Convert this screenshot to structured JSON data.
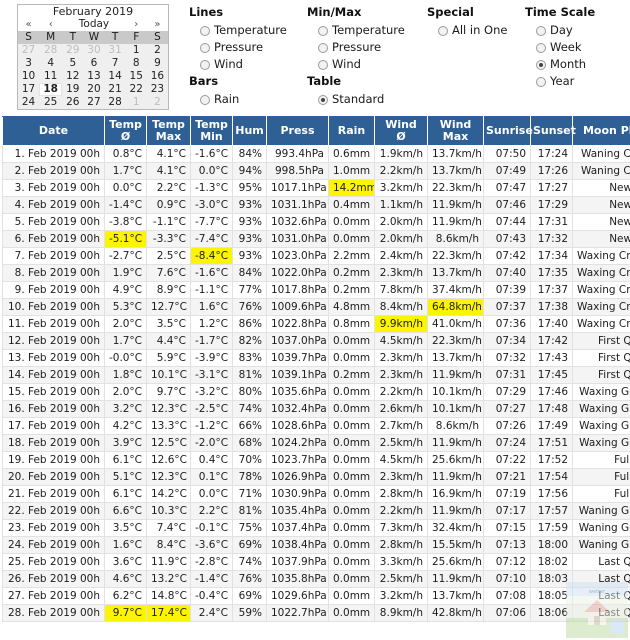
{
  "calendar": {
    "title": "February 2019",
    "nav": {
      "first": "«",
      "prev": "‹",
      "today": "Today",
      "next": "›",
      "last": "»"
    },
    "dow": [
      "S",
      "M",
      "T",
      "W",
      "T",
      "F",
      "S"
    ],
    "weeks": [
      [
        {
          "d": "27",
          "o": true
        },
        {
          "d": "28",
          "o": true
        },
        {
          "d": "29",
          "o": true
        },
        {
          "d": "30",
          "o": true
        },
        {
          "d": "31",
          "o": true
        },
        {
          "d": "1",
          "o": false
        },
        {
          "d": "2",
          "o": false
        }
      ],
      [
        {
          "d": "3",
          "o": false
        },
        {
          "d": "4",
          "o": false
        },
        {
          "d": "5",
          "o": false
        },
        {
          "d": "6",
          "o": false
        },
        {
          "d": "7",
          "o": false
        },
        {
          "d": "8",
          "o": false
        },
        {
          "d": "9",
          "o": false
        }
      ],
      [
        {
          "d": "10",
          "o": false
        },
        {
          "d": "11",
          "o": false
        },
        {
          "d": "12",
          "o": false
        },
        {
          "d": "13",
          "o": false
        },
        {
          "d": "14",
          "o": false
        },
        {
          "d": "15",
          "o": false
        },
        {
          "d": "16",
          "o": false
        }
      ],
      [
        {
          "d": "17",
          "o": false
        },
        {
          "d": "18",
          "o": false,
          "sel": true
        },
        {
          "d": "19",
          "o": false
        },
        {
          "d": "20",
          "o": false
        },
        {
          "d": "21",
          "o": false
        },
        {
          "d": "22",
          "o": false
        },
        {
          "d": "23",
          "o": false
        }
      ],
      [
        {
          "d": "24",
          "o": false
        },
        {
          "d": "25",
          "o": false
        },
        {
          "d": "26",
          "o": false
        },
        {
          "d": "27",
          "o": false
        },
        {
          "d": "28",
          "o": false
        },
        {
          "d": "1",
          "o": true
        },
        {
          "d": "2",
          "o": true
        }
      ]
    ]
  },
  "options": {
    "lines": {
      "title": "Lines",
      "items": [
        {
          "label": "Temperature",
          "checked": false
        },
        {
          "label": "Pressure",
          "checked": false
        },
        {
          "label": "Wind",
          "checked": false
        }
      ]
    },
    "bars": {
      "title": "Bars",
      "items": [
        {
          "label": "Rain",
          "checked": false
        }
      ]
    },
    "minmax": {
      "title": "Min/Max",
      "items": [
        {
          "label": "Temperature",
          "checked": false
        },
        {
          "label": "Pressure",
          "checked": false
        },
        {
          "label": "Wind",
          "checked": false
        }
      ]
    },
    "table": {
      "title": "Table",
      "items": [
        {
          "label": "Standard",
          "checked": true
        }
      ]
    },
    "special": {
      "title": "Special",
      "items": [
        {
          "label": "All in One",
          "checked": false
        }
      ]
    },
    "time": {
      "title": "Time Scale",
      "items": [
        {
          "label": "Day",
          "checked": false
        },
        {
          "label": "Week",
          "checked": false
        },
        {
          "label": "Month",
          "checked": true
        },
        {
          "label": "Year",
          "checked": false
        }
      ]
    }
  },
  "table": {
    "columns": [
      {
        "key": "date",
        "label": "Date"
      },
      {
        "key": "tavg",
        "label": "Temp\nØ"
      },
      {
        "key": "tmax",
        "label": "Temp\nMax"
      },
      {
        "key": "tmin",
        "label": "Temp\nMin"
      },
      {
        "key": "hum",
        "label": "Hum"
      },
      {
        "key": "press",
        "label": "Press"
      },
      {
        "key": "rain",
        "label": "Rain"
      },
      {
        "key": "wavg",
        "label": "Wind\nØ"
      },
      {
        "key": "wmax",
        "label": "Wind\nMax"
      },
      {
        "key": "sunrise",
        "label": "Sunrise"
      },
      {
        "key": "sunset",
        "label": "Sunset"
      },
      {
        "key": "moon",
        "label": "Moon Phase"
      }
    ],
    "rows": [
      {
        "date": "1. Feb 2019 00h",
        "tavg": "0.8°C",
        "tmax": "4.1°C",
        "tmin": "-1.6°C",
        "hum": "84%",
        "press": "993.4hPa",
        "rain": "0.6mm",
        "wavg": "1.9km/h",
        "wmax": "13.7km/h",
        "sunrise": "07:50",
        "sunset": "17:24",
        "moon": "Waning Cresent"
      },
      {
        "date": "2. Feb 2019 00h",
        "tavg": "1.7°C",
        "tmax": "4.1°C",
        "tmin": "0.0°C",
        "hum": "94%",
        "press": "998.5hPa",
        "rain": "1.0mm",
        "wavg": "2.2km/h",
        "wmax": "13.7km/h",
        "sunrise": "07:49",
        "sunset": "17:26",
        "moon": "Waning Cresent"
      },
      {
        "date": "3. Feb 2019 00h",
        "tavg": "0.0°C",
        "tmax": "2.2°C",
        "tmin": "-1.3°C",
        "hum": "95%",
        "press": "1017.1hPa",
        "rain": "14.2mm",
        "wavg": "3.2km/h",
        "wmax": "22.3km/h",
        "sunrise": "07:47",
        "sunset": "17:27",
        "moon": "New Moon",
        "hl": [
          "rain"
        ]
      },
      {
        "date": "4. Feb 2019 00h",
        "tavg": "-1.4°C",
        "tmax": "0.9°C",
        "tmin": "-3.0°C",
        "hum": "93%",
        "press": "1031.1hPa",
        "rain": "0.4mm",
        "wavg": "1.1km/h",
        "wmax": "11.9km/h",
        "sunrise": "07:46",
        "sunset": "17:29",
        "moon": "New Moon"
      },
      {
        "date": "5. Feb 2019 00h",
        "tavg": "-3.8°C",
        "tmax": "-1.1°C",
        "tmin": "-7.7°C",
        "hum": "93%",
        "press": "1032.6hPa",
        "rain": "0.0mm",
        "wavg": "2.0km/h",
        "wmax": "11.9km/h",
        "sunrise": "07:44",
        "sunset": "17:31",
        "moon": "New Moon"
      },
      {
        "date": "6. Feb 2019 00h",
        "tavg": "-5.1°C",
        "tmax": "-3.3°C",
        "tmin": "-7.4°C",
        "hum": "93%",
        "press": "1031.0hPa",
        "rain": "0.0mm",
        "wavg": "2.0km/h",
        "wmax": "8.6km/h",
        "sunrise": "07:43",
        "sunset": "17:32",
        "moon": "New Moon",
        "hl": [
          "tavg"
        ]
      },
      {
        "date": "7. Feb 2019 00h",
        "tavg": "-2.7°C",
        "tmax": "2.5°C",
        "tmin": "-8.4°C",
        "hum": "93%",
        "press": "1023.0hPa",
        "rain": "2.2mm",
        "wavg": "2.4km/h",
        "wmax": "22.3km/h",
        "sunrise": "07:42",
        "sunset": "17:34",
        "moon": "Waxing Crescent",
        "hl": [
          "tmin"
        ]
      },
      {
        "date": "8. Feb 2019 00h",
        "tavg": "1.9°C",
        "tmax": "7.6°C",
        "tmin": "-1.6°C",
        "hum": "84%",
        "press": "1022.0hPa",
        "rain": "0.2mm",
        "wavg": "2.3km/h",
        "wmax": "13.7km/h",
        "sunrise": "07:40",
        "sunset": "17:35",
        "moon": "Waxing Crescent"
      },
      {
        "date": "9. Feb 2019 00h",
        "tavg": "4.9°C",
        "tmax": "8.9°C",
        "tmin": "-1.1°C",
        "hum": "77%",
        "press": "1017.8hPa",
        "rain": "0.2mm",
        "wavg": "7.8km/h",
        "wmax": "37.4km/h",
        "sunrise": "07:39",
        "sunset": "17:37",
        "moon": "Waxing Crescent"
      },
      {
        "date": "10. Feb 2019 00h",
        "tavg": "5.3°C",
        "tmax": "12.7°C",
        "tmin": "1.6°C",
        "hum": "76%",
        "press": "1009.6hPa",
        "rain": "4.8mm",
        "wavg": "8.4km/h",
        "wmax": "64.8km/h",
        "sunrise": "07:37",
        "sunset": "17:38",
        "moon": "Waxing Crescent",
        "hl": [
          "wmax"
        ]
      },
      {
        "date": "11. Feb 2019 00h",
        "tavg": "2.0°C",
        "tmax": "3.5°C",
        "tmin": "1.2°C",
        "hum": "86%",
        "press": "1022.8hPa",
        "rain": "0.8mm",
        "wavg": "9.9km/h",
        "wmax": "41.0km/h",
        "sunrise": "07:36",
        "sunset": "17:40",
        "moon": "Waxing Crescent",
        "hl": [
          "wavg"
        ]
      },
      {
        "date": "12. Feb 2019 00h",
        "tavg": "1.7°C",
        "tmax": "4.4°C",
        "tmin": "-1.7°C",
        "hum": "82%",
        "press": "1037.0hPa",
        "rain": "0.0mm",
        "wavg": "4.5km/h",
        "wmax": "22.3km/h",
        "sunrise": "07:34",
        "sunset": "17:42",
        "moon": "First Quarter"
      },
      {
        "date": "13. Feb 2019 00h",
        "tavg": "-0.0°C",
        "tmax": "5.9°C",
        "tmin": "-3.9°C",
        "hum": "83%",
        "press": "1039.7hPa",
        "rain": "0.0mm",
        "wavg": "2.3km/h",
        "wmax": "13.7km/h",
        "sunrise": "07:32",
        "sunset": "17:43",
        "moon": "First Quarter"
      },
      {
        "date": "14. Feb 2019 00h",
        "tavg": "1.8°C",
        "tmax": "10.1°C",
        "tmin": "-3.1°C",
        "hum": "81%",
        "press": "1039.1hPa",
        "rain": "0.2mm",
        "wavg": "2.3km/h",
        "wmax": "11.9km/h",
        "sunrise": "07:31",
        "sunset": "17:45",
        "moon": "First Quarter"
      },
      {
        "date": "15. Feb 2019 00h",
        "tavg": "2.0°C",
        "tmax": "9.7°C",
        "tmin": "-3.2°C",
        "hum": "80%",
        "press": "1035.6hPa",
        "rain": "0.0mm",
        "wavg": "2.2km/h",
        "wmax": "10.1km/h",
        "sunrise": "07:29",
        "sunset": "17:46",
        "moon": "Waxing Gibbous"
      },
      {
        "date": "16. Feb 2019 00h",
        "tavg": "3.2°C",
        "tmax": "12.3°C",
        "tmin": "-2.5°C",
        "hum": "74%",
        "press": "1032.4hPa",
        "rain": "0.0mm",
        "wavg": "2.6km/h",
        "wmax": "10.1km/h",
        "sunrise": "07:27",
        "sunset": "17:48",
        "moon": "Waxing Gibbous"
      },
      {
        "date": "17. Feb 2019 00h",
        "tavg": "4.2°C",
        "tmax": "13.3°C",
        "tmin": "-1.2°C",
        "hum": "66%",
        "press": "1028.6hPa",
        "rain": "0.0mm",
        "wavg": "2.7km/h",
        "wmax": "8.6km/h",
        "sunrise": "07:26",
        "sunset": "17:49",
        "moon": "Waxing Gibbous"
      },
      {
        "date": "18. Feb 2019 00h",
        "tavg": "3.9°C",
        "tmax": "12.5°C",
        "tmin": "-2.0°C",
        "hum": "68%",
        "press": "1024.2hPa",
        "rain": "0.0mm",
        "wavg": "2.5km/h",
        "wmax": "11.9km/h",
        "sunrise": "07:24",
        "sunset": "17:51",
        "moon": "Waxing Gibbous"
      },
      {
        "date": "19. Feb 2019 00h",
        "tavg": "6.1°C",
        "tmax": "12.6°C",
        "tmin": "0.4°C",
        "hum": "70%",
        "press": "1023.7hPa",
        "rain": "0.0mm",
        "wavg": "4.5km/h",
        "wmax": "25.6km/h",
        "sunrise": "07:22",
        "sunset": "17:52",
        "moon": "Full Moon"
      },
      {
        "date": "20. Feb 2019 00h",
        "tavg": "5.1°C",
        "tmax": "12.3°C",
        "tmin": "0.1°C",
        "hum": "78%",
        "press": "1026.9hPa",
        "rain": "0.0mm",
        "wavg": "2.3km/h",
        "wmax": "11.9km/h",
        "sunrise": "07:21",
        "sunset": "17:54",
        "moon": "Full Moon"
      },
      {
        "date": "21. Feb 2019 00h",
        "tavg": "6.1°C",
        "tmax": "14.2°C",
        "tmin": "0.0°C",
        "hum": "71%",
        "press": "1030.9hPa",
        "rain": "0.0mm",
        "wavg": "2.8km/h",
        "wmax": "16.9km/h",
        "sunrise": "07:19",
        "sunset": "17:56",
        "moon": "Full Moon"
      },
      {
        "date": "22. Feb 2019 00h",
        "tavg": "6.6°C",
        "tmax": "10.3°C",
        "tmin": "2.2°C",
        "hum": "81%",
        "press": "1035.4hPa",
        "rain": "0.0mm",
        "wavg": "2.2km/h",
        "wmax": "11.9km/h",
        "sunrise": "07:17",
        "sunset": "17:57",
        "moon": "Waning Gibbous"
      },
      {
        "date": "23. Feb 2019 00h",
        "tavg": "3.5°C",
        "tmax": "7.4°C",
        "tmin": "-0.1°C",
        "hum": "75%",
        "press": "1037.4hPa",
        "rain": "0.0mm",
        "wavg": "7.3km/h",
        "wmax": "32.4km/h",
        "sunrise": "07:15",
        "sunset": "17:59",
        "moon": "Waning Gibbous"
      },
      {
        "date": "24. Feb 2019 00h",
        "tavg": "1.6°C",
        "tmax": "8.4°C",
        "tmin": "-3.6°C",
        "hum": "69%",
        "press": "1038.4hPa",
        "rain": "0.0mm",
        "wavg": "2.8km/h",
        "wmax": "15.5km/h",
        "sunrise": "07:13",
        "sunset": "18:00",
        "moon": "Waning Gibbous"
      },
      {
        "date": "25. Feb 2019 00h",
        "tavg": "3.6°C",
        "tmax": "11.9°C",
        "tmin": "-2.8°C",
        "hum": "74%",
        "press": "1037.9hPa",
        "rain": "0.0mm",
        "wavg": "3.3km/h",
        "wmax": "25.6km/h",
        "sunrise": "07:12",
        "sunset": "18:02",
        "moon": "Last Quarter"
      },
      {
        "date": "26. Feb 2019 00h",
        "tavg": "4.6°C",
        "tmax": "13.2°C",
        "tmin": "-1.4°C",
        "hum": "76%",
        "press": "1035.8hPa",
        "rain": "0.0mm",
        "wavg": "2.5km/h",
        "wmax": "11.9km/h",
        "sunrise": "07:10",
        "sunset": "18:03",
        "moon": "Last Quarter"
      },
      {
        "date": "27. Feb 2019 00h",
        "tavg": "6.2°C",
        "tmax": "14.8°C",
        "tmin": "-0.4°C",
        "hum": "69%",
        "press": "1029.6hPa",
        "rain": "0.0mm",
        "wavg": "3.2km/h",
        "wmax": "13.7km/h",
        "sunrise": "07:08",
        "sunset": "18:05",
        "moon": "Last Quarter"
      },
      {
        "date": "28. Feb 2019 00h",
        "tavg": "9.7°C",
        "tmax": "17.4°C",
        "tmin": "2.4°C",
        "hum": "59%",
        "press": "1022.7hPa",
        "rain": "0.0mm",
        "wavg": "8.9km/h",
        "wmax": "42.8km/h",
        "sunrise": "07:06",
        "sunset": "18:06",
        "moon": "Last Quarter",
        "hl": [
          "tavg",
          "tmax"
        ]
      }
    ]
  },
  "colors": {
    "header_bg": "#2e6096",
    "highlight": "#fdf500",
    "row_alt": "#f4f4f4"
  }
}
